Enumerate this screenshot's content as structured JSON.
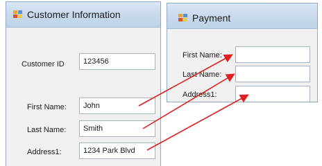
{
  "customer_window": {
    "title": "Customer Information",
    "fields": [
      {
        "label": "Customer ID",
        "value": "123456"
      },
      {
        "label": "First Name:",
        "value": "John"
      },
      {
        "label": "Last Name:",
        "value": "Smith"
      },
      {
        "label": "Address1:",
        "value": "1234 Park Blvd"
      }
    ]
  },
  "payment_window": {
    "title": "Payment",
    "fields": [
      {
        "label": "First Name:",
        "value": ""
      },
      {
        "label": "Last Name:",
        "value": ""
      },
      {
        "label": "Address1:",
        "value": ""
      }
    ]
  },
  "arrow_color": "#e02020",
  "icons": {
    "app_icon": "windows-form-app-icon"
  }
}
